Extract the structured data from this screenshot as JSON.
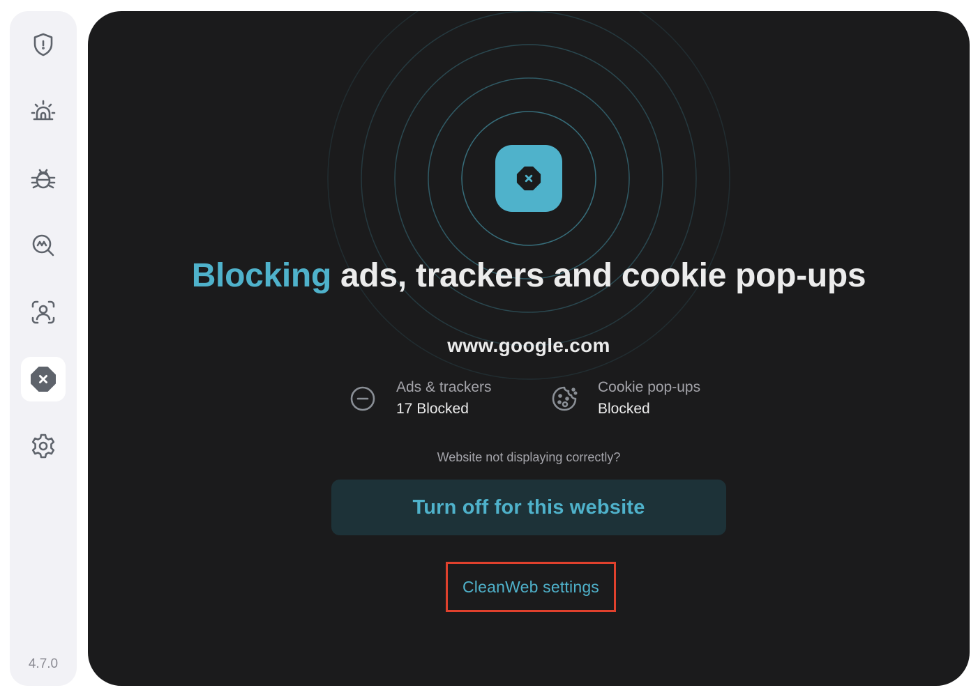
{
  "sidebar": {
    "items": [
      {
        "name": "shield-icon",
        "label": "Antivirus"
      },
      {
        "name": "alarm-icon",
        "label": "Alert"
      },
      {
        "name": "bug-icon",
        "label": "Malware scan"
      },
      {
        "name": "search-scan-icon",
        "label": "Search"
      },
      {
        "name": "face-scan-icon",
        "label": "Identity"
      },
      {
        "name": "cleanweb-icon",
        "label": "CleanWeb",
        "active": true
      },
      {
        "name": "gear-icon",
        "label": "Settings"
      }
    ],
    "version": "4.7.0"
  },
  "main": {
    "headline_accent": "Blocking",
    "headline_rest": " ads, trackers and cookie pop-ups",
    "domain": "www.google.com",
    "stats": {
      "ads": {
        "label": "Ads & trackers",
        "value": "17 Blocked",
        "icon": "minus-circle-icon"
      },
      "cookies": {
        "label": "Cookie pop-ups",
        "value": "Blocked",
        "icon": "cookie-icon"
      }
    },
    "question": "Website not displaying correctly?",
    "turn_off_label": "Turn off for this website",
    "settings_link": "CleanWeb settings"
  },
  "colors": {
    "accent": "#4fb2cb",
    "background": "#1b1b1c",
    "sidebar": "#f2f2f6",
    "highlight_border": "#e0412d"
  }
}
